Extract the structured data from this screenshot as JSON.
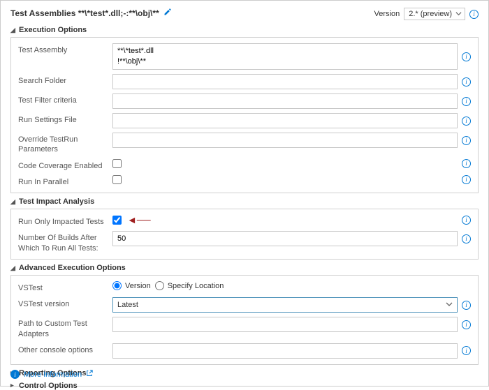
{
  "header": {
    "title": "Test Assemblies **\\*test*.dll;-:**\\obj\\**",
    "version_label": "Version",
    "version_value": "2.* (preview)"
  },
  "sections": {
    "exec": {
      "title": "Execution Options",
      "test_assembly_label": "Test Assembly",
      "test_assembly_value": "**\\*test*.dll\n!**\\obj\\**",
      "search_folder_label": "Search Folder",
      "search_folder_value": "",
      "filter_label": "Test Filter criteria",
      "filter_value": "",
      "runsettings_label": "Run Settings File",
      "runsettings_value": "",
      "override_label": "Override TestRun Parameters",
      "override_value": "",
      "codecov_label": "Code Coverage Enabled",
      "parallel_label": "Run In Parallel"
    },
    "tia": {
      "title": "Test Impact Analysis",
      "impacted_label": "Run Only Impacted Tests",
      "builds_label": "Number Of Builds After Which To Run All Tests:",
      "builds_value": "50"
    },
    "adv": {
      "title": "Advanced Execution Options",
      "vstest_label": "VSTest",
      "radio_version": "Version",
      "radio_location": "Specify Location",
      "vstest_version_label": "VSTest version",
      "vstest_version_value": "Latest",
      "adapters_label": "Path to Custom Test Adapters",
      "adapters_value": "",
      "console_label": "Other console options",
      "console_value": ""
    },
    "reporting": {
      "title": "Reporting Options"
    },
    "control": {
      "title": "Control Options"
    }
  },
  "footer": {
    "more_info": "More Information"
  }
}
